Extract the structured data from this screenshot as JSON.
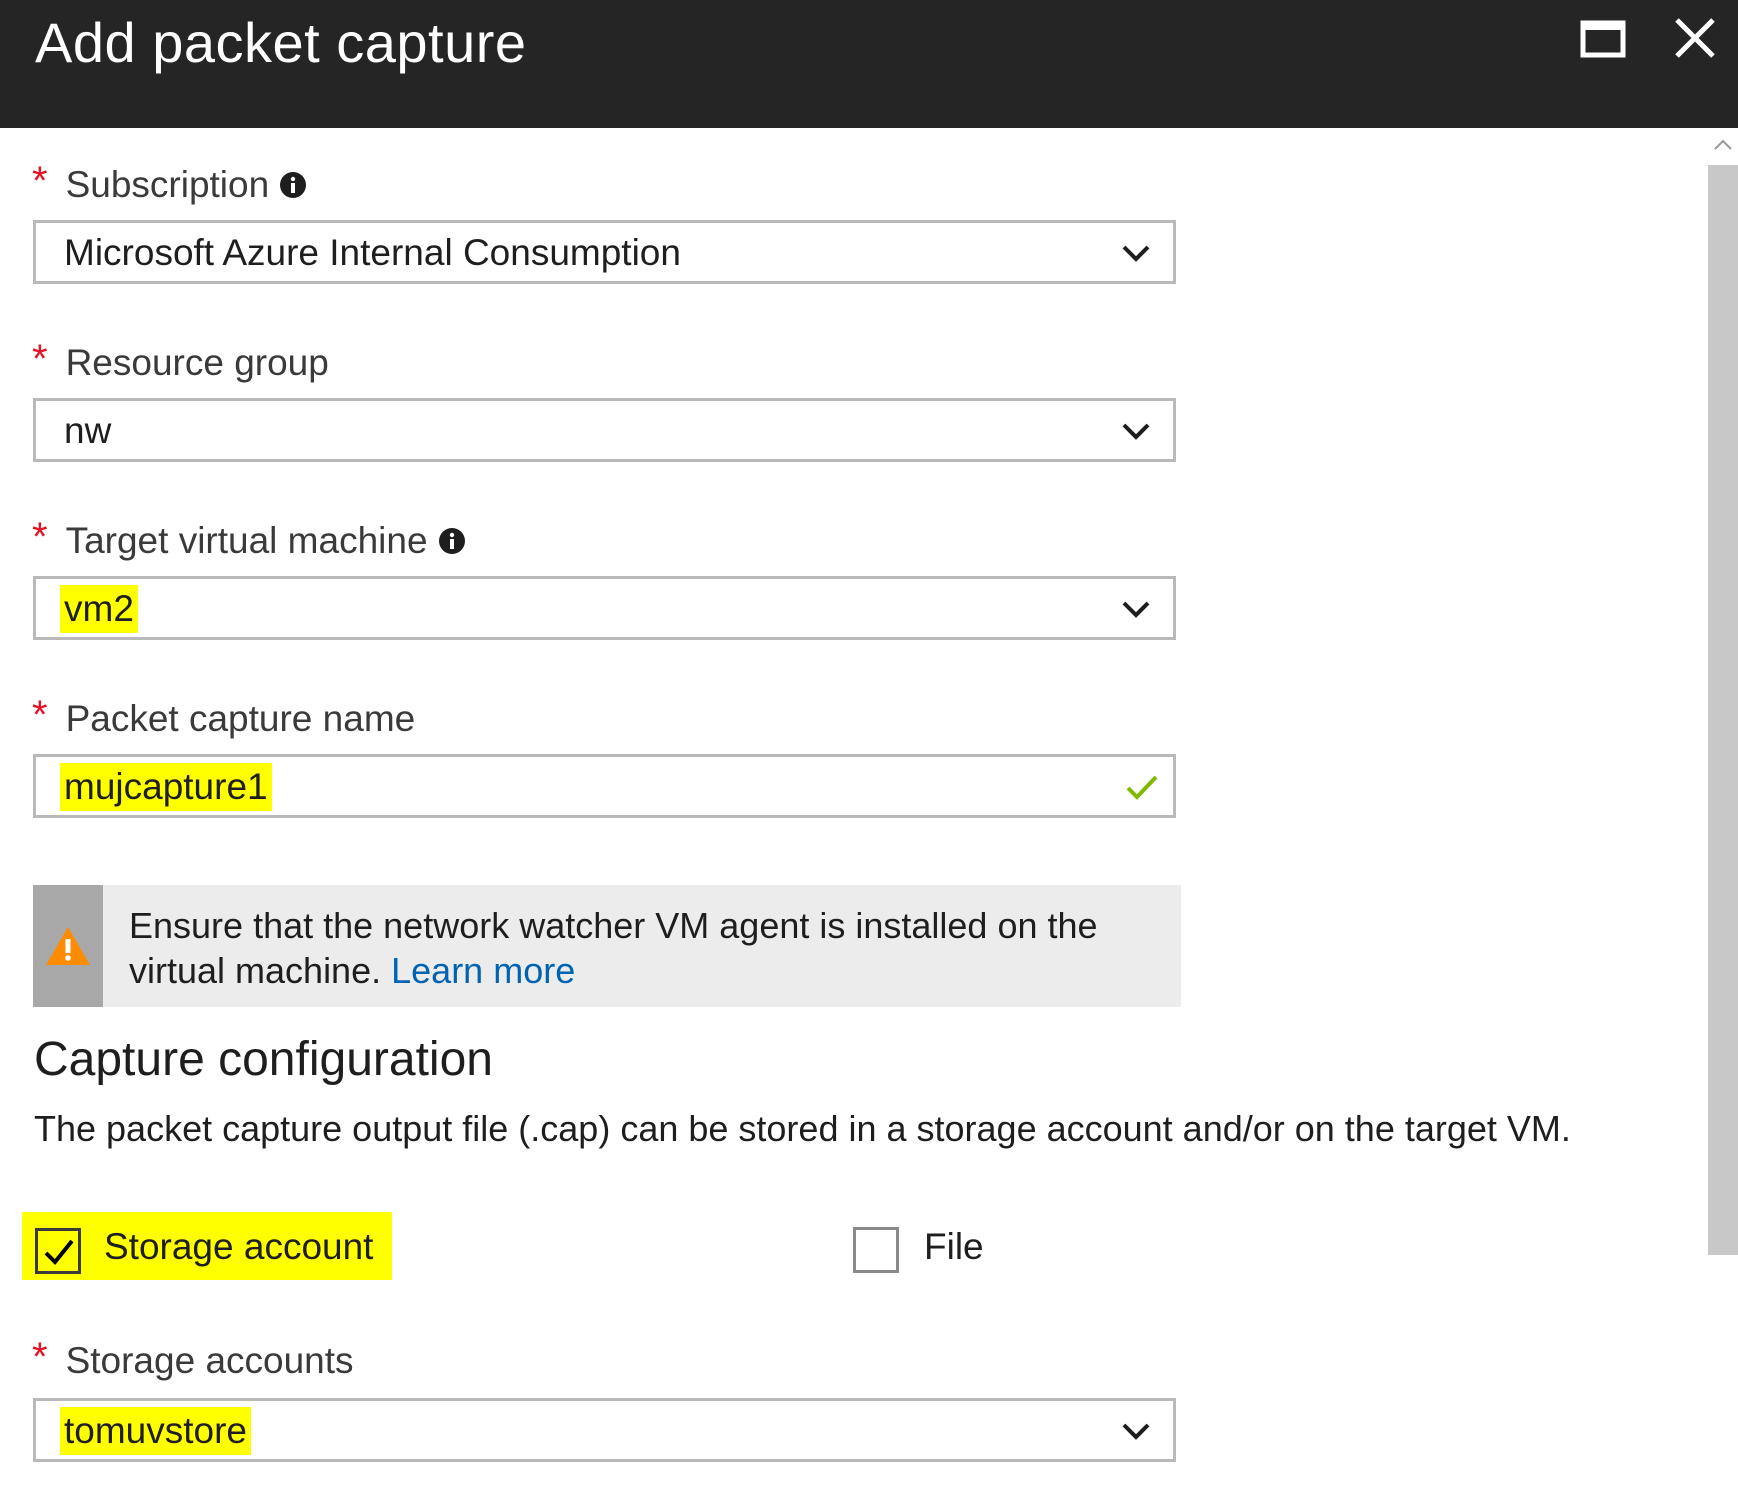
{
  "window": {
    "title": "Add packet capture",
    "maximize_icon": "maximize-icon",
    "close_icon": "close-icon"
  },
  "form": {
    "subscription": {
      "label": "Subscription",
      "required_mark": "*",
      "value": "Microsoft Azure Internal Consumption"
    },
    "resource_group": {
      "label": "Resource group",
      "required_mark": "*",
      "value": "nw"
    },
    "target_vm": {
      "label": "Target virtual machine",
      "required_mark": "*",
      "value": "vm2"
    },
    "capture_name": {
      "label": "Packet capture name",
      "required_mark": "*",
      "value": "mujcapture1"
    },
    "warning": {
      "text": "Ensure that the network watcher VM agent is installed on the virtual machine.",
      "link": "Learn more"
    },
    "capture_configuration": {
      "title": "Capture configuration",
      "description": "The packet capture output file (.cap) can be stored in a storage account and/or on the target VM.",
      "storage_account_option": {
        "label": "Storage account",
        "checked": true
      },
      "file_option": {
        "label": "File",
        "checked": false
      }
    },
    "storage_accounts": {
      "label": "Storage accounts",
      "required_mark": "*",
      "value": "tomuvstore"
    }
  },
  "colors": {
    "title_bar": "#252525",
    "required": "#e81123",
    "link": "#0063b1",
    "highlight": "#ffff00",
    "valid_check": "#7fba00",
    "warning_icon": "#ff8c00"
  }
}
